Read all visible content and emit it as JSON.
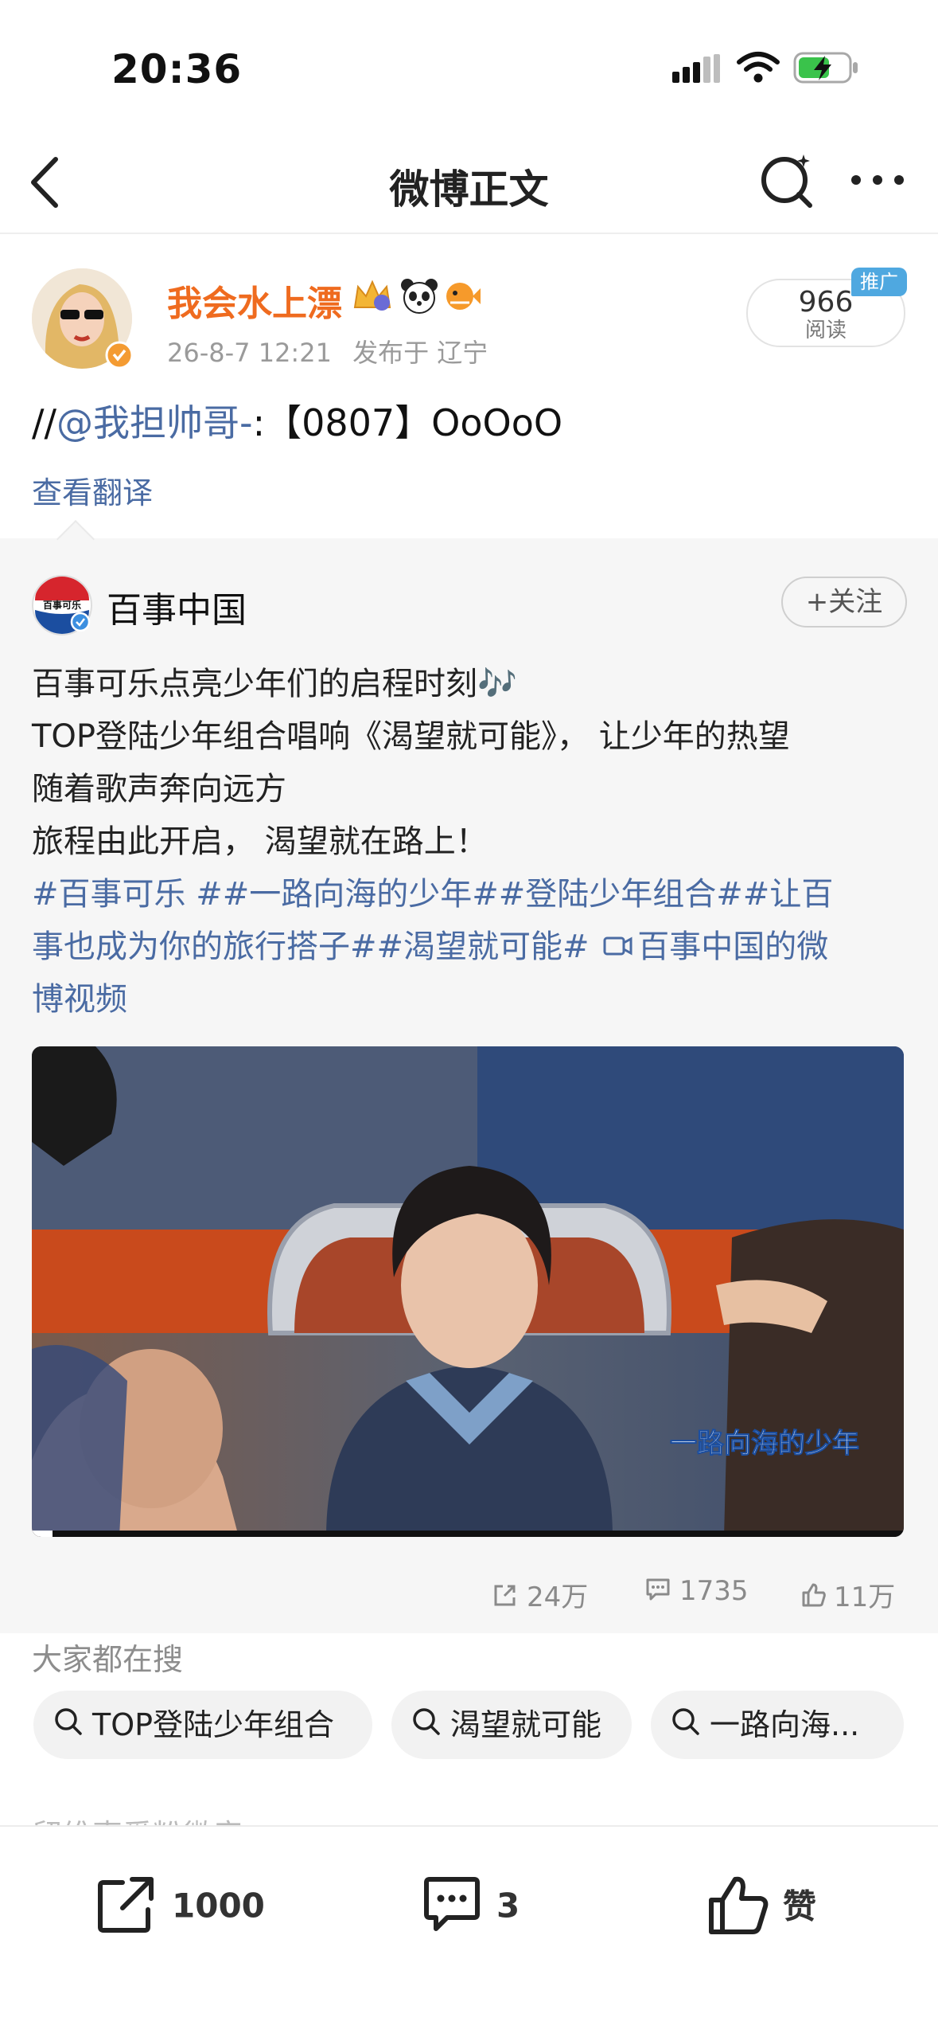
{
  "status_bar": {
    "time": "20:36"
  },
  "nav": {
    "title": "微博正文"
  },
  "post": {
    "author": "我会水上漂",
    "timestamp": "26-8-7 12:21",
    "location": "发布于 辽宁",
    "reads_count": "966",
    "reads_label": "阅读",
    "promo_badge": "推广",
    "text_prefix": "//",
    "mention": "@我担帅哥-",
    "text_suffix": ":【0807】OoOoO",
    "translate": "查看翻译"
  },
  "repost": {
    "author": "百事中国",
    "follow": "+关注",
    "logo_text": "百事可乐",
    "lines": [
      "百事可乐点亮少年们的启程时刻🎶",
      "TOP登陆少年组合唱响《渴望就可能》， 让少年的热望",
      "随着歌声奔向远方",
      "旅程由此开启， 渴望就在路上！"
    ],
    "tags_line1": "#百事可乐 ##一路向海的少年##登陆少年组合##让百",
    "tags_line2_a": "事也成为你的旅行搭子##渴望就可能#",
    "tags_line2_b": "百事中国的微",
    "tags_line3": "博视频",
    "video_watermark": "一路向海的少年",
    "stats": {
      "reposts": "24万",
      "comments": "1735",
      "likes": "11万"
    }
  },
  "search": {
    "title": "大家都在搜",
    "chips": [
      "TOP登陆少年组合",
      "渴望就可能",
      "一路向海..."
    ]
  },
  "cutoff_text": "留维声爱粉微音",
  "bottom_bar": {
    "repost_count": "1000",
    "comment_count": "3",
    "like_label": "赞"
  },
  "colors": {
    "accent_orange": "#ef6b1f",
    "link_blue": "#4a6ba3"
  }
}
